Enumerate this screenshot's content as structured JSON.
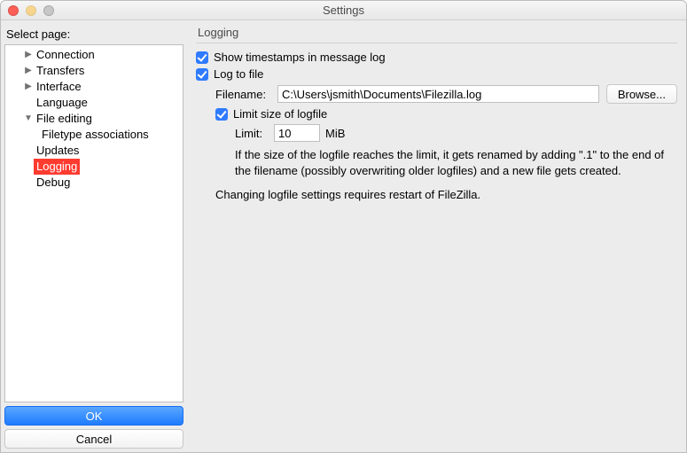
{
  "window": {
    "title": "Settings"
  },
  "sidebar": {
    "label": "Select page:",
    "items": [
      {
        "label": "Connection",
        "expandable": true,
        "expanded": false
      },
      {
        "label": "Transfers",
        "expandable": true,
        "expanded": false
      },
      {
        "label": "Interface",
        "expandable": true,
        "expanded": false
      },
      {
        "label": "Language",
        "expandable": false
      },
      {
        "label": "File editing",
        "expandable": true,
        "expanded": true,
        "children": [
          {
            "label": "Filetype associations"
          }
        ]
      },
      {
        "label": "Updates",
        "expandable": false
      },
      {
        "label": "Logging",
        "expandable": false,
        "selected": true
      },
      {
        "label": "Debug",
        "expandable": false
      }
    ],
    "ok_label": "OK",
    "cancel_label": "Cancel"
  },
  "panel": {
    "header": "Logging",
    "show_timestamps": {
      "checked": true,
      "label": "Show timestamps in message log"
    },
    "log_to_file": {
      "checked": true,
      "label": "Log to file"
    },
    "filename_label": "Filename:",
    "filename_value": "C:\\Users\\jsmith\\Documents\\Filezilla.log",
    "browse_label": "Browse...",
    "limit_size": {
      "checked": true,
      "label": "Limit size of logfile"
    },
    "limit_label": "Limit:",
    "limit_value": "10",
    "limit_unit": "MiB",
    "limit_help": "If the size of the logfile reaches the limit, it gets renamed by adding \".1\" to the end of the filename (possibly overwriting older logfiles) and a new file gets created.",
    "restart_note": "Changing logfile settings requires restart of FileZilla."
  }
}
